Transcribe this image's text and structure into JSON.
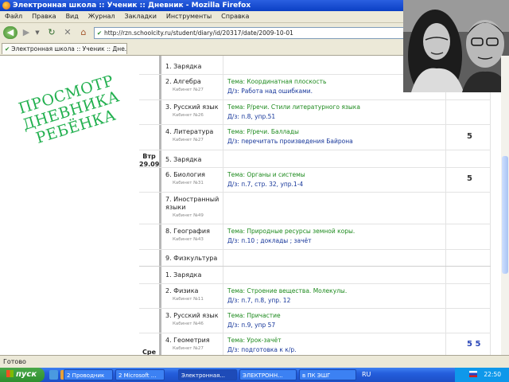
{
  "window": {
    "title": "Электронная школа :: Ученик :: Дневник - Mozilla Firefox",
    "menu": [
      "Файл",
      "Правка",
      "Вид",
      "Журнал",
      "Закладки",
      "Инструменты",
      "Справка"
    ],
    "url": "http://rzn.schoolcity.ru/student/diary/id/20317/date/2009-10-01",
    "tab": "Электронная школа :: Ученик :: Дне...",
    "status": "Готово"
  },
  "promo": [
    "ПРОСМОТР",
    "ДНЕВНИКА",
    "РЕБЁНКА"
  ],
  "diary": {
    "day1": {
      "label_top": "Втр",
      "label_bottom": "29.09"
    },
    "day2": {
      "label": "Сре"
    },
    "rows": [
      {
        "subject": "1. Зарядка",
        "room": "",
        "topic": "",
        "homework": "",
        "grade": ""
      },
      {
        "subject": "2. Алгебра",
        "room": "Кабинет №27",
        "topic": "Тема: Координатная плоскость",
        "homework": "Д/з: Работа над ошибками.",
        "grade": ""
      },
      {
        "subject": "3. Русский язык",
        "room": "Кабинет №26",
        "topic": "Тема: Р/речи. Стили литературного языка",
        "homework": "Д/з: п.8, упр.51",
        "grade": ""
      },
      {
        "subject": "4. Литература",
        "room": "Кабинет №27",
        "topic": "Тема: Р/речи. Баллады",
        "homework": "Д/з: перечитать произведения Байрона",
        "grade": "5"
      },
      {
        "subject": "5. Зарядка",
        "room": "",
        "topic": "",
        "homework": "",
        "grade": ""
      },
      {
        "subject": "6. Биология",
        "room": "Кабинет №31",
        "topic": "Тема: Органы и системы",
        "homework": "Д/з: п.7, стр. 32, упр.1-4",
        "grade": "5"
      },
      {
        "subject": "7. Иностранный",
        "subject2": "языки",
        "room": "Кабинет №49",
        "topic": "",
        "homework": "",
        "grade": ""
      },
      {
        "subject": "8. География",
        "room": "Кабинет №43",
        "topic": "Тема: Природные ресурсы земной коры.",
        "homework": "Д/з: п.10 ; доклады ; зачёт",
        "grade": ""
      },
      {
        "subject": "9. Физкультура",
        "room": "",
        "topic": "",
        "homework": "",
        "grade": ""
      },
      {
        "subject": "1. Зарядка",
        "room": "",
        "topic": "",
        "homework": "",
        "grade": ""
      },
      {
        "subject": "2. Физика",
        "room": "Кабинет №11",
        "topic": "Тема: Строение вещества. Молекулы.",
        "homework": "Д/з: п.7, п.8, упр. 12",
        "grade": ""
      },
      {
        "subject": "3. Русский язык",
        "room": "Кабинет №46",
        "topic": "Тема: Причастие",
        "homework": "Д/з: п.9, упр 57",
        "grade": ""
      },
      {
        "subject": "4. Геометрия",
        "room": "Кабинет №27",
        "topic": "Тема: Урок-зачёт",
        "homework": "Д/з: подготовка к к/р.",
        "grade": "5 5"
      }
    ]
  },
  "taskbar": {
    "start": "пуск",
    "tasks": [
      "2 Проводник",
      "2 Microsoft ...",
      "Электронная...",
      "ЭЛЕКТРОНН...",
      "в ПК ЭШГ"
    ],
    "lang": "RU",
    "clock": "22:50"
  }
}
